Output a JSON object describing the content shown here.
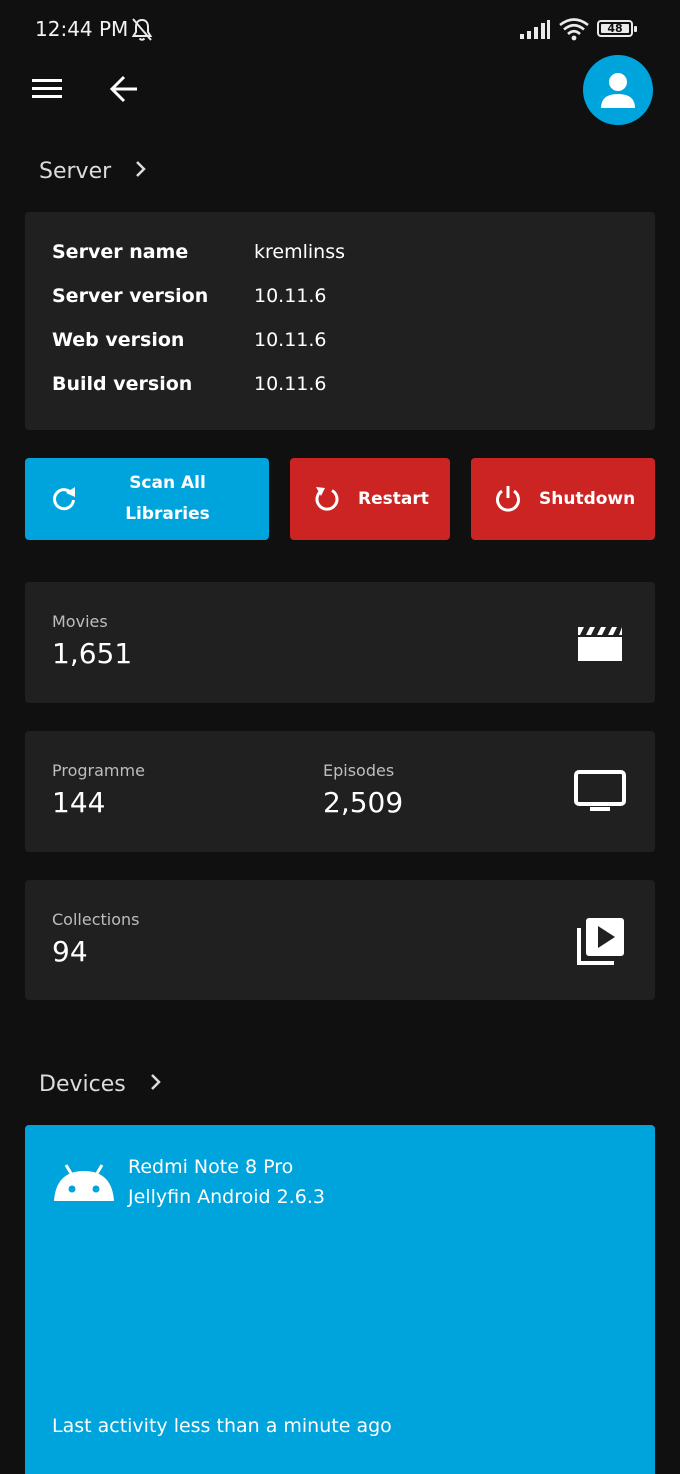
{
  "status_bar": {
    "time": "12:44 PM",
    "battery": "48",
    "icons": [
      "bell-off-icon",
      "signal-icon",
      "wifi-icon",
      "battery-icon"
    ]
  },
  "app_bar": {
    "icons": [
      "menu-icon",
      "back-arrow-icon",
      "user-avatar-icon"
    ]
  },
  "server": {
    "header": "Server",
    "rows": [
      {
        "label": "Server name",
        "value": "kremlinss"
      },
      {
        "label": "Server version",
        "value": "10.11.6"
      },
      {
        "label": "Web version",
        "value": "10.11.6"
      },
      {
        "label": "Build version",
        "value": "10.11.6"
      }
    ]
  },
  "actions": {
    "scan_line1": "Scan All",
    "scan_line2": "Libraries",
    "restart": "Restart",
    "shutdown": "Shutdown"
  },
  "stats": {
    "movies_label": "Movies",
    "movies_value": "1,651",
    "programme_label": "Programme",
    "programme_value": "144",
    "episodes_label": "Episodes",
    "episodes_value": "2,509",
    "collections_label": "Collections",
    "collections_value": "94"
  },
  "devices": {
    "header": "Devices",
    "items": [
      {
        "name": "Redmi Note 8 Pro",
        "app": "Jellyfin Android 2.6.3",
        "activity": "Last activity less than a minute ago"
      }
    ]
  },
  "colors": {
    "background": "#101010",
    "card": "#202020",
    "accent": "#00a4dc",
    "danger": "#cc2323"
  }
}
